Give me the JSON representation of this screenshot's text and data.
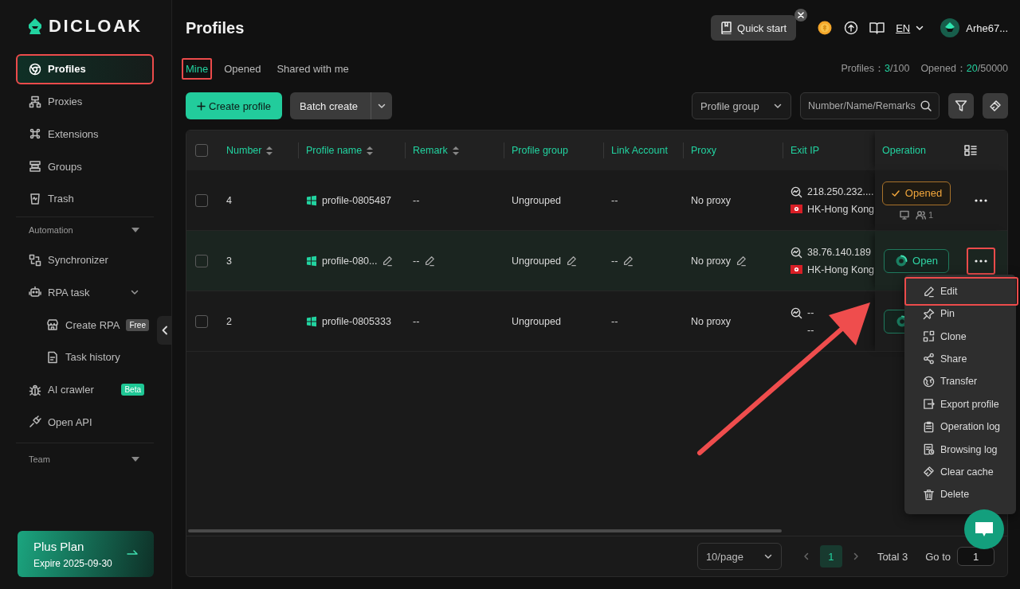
{
  "sidebar": {
    "logo": "DICLOAK",
    "items": [
      {
        "label": "Profiles",
        "selected": true,
        "annotated": true
      },
      {
        "label": "Proxies",
        "selected": false,
        "annotated": false
      },
      {
        "label": "Extensions",
        "selected": false,
        "annotated": false
      },
      {
        "label": "Groups",
        "selected": false,
        "annotated": false
      },
      {
        "label": "Trash",
        "selected": false,
        "annotated": false
      }
    ],
    "sections": [
      {
        "title": "Automation",
        "items": [
          {
            "label": "Synchronizer",
            "selected": false
          },
          {
            "label": "RPA task",
            "selected": false,
            "expanded": true,
            "children": [
              {
                "label": "Create RPA",
                "selected": false,
                "badge": {
                  "text": "Free",
                  "color": "#4d4d4d"
                }
              },
              {
                "label": "Task history",
                "selected": false
              }
            ]
          },
          {
            "label": "AI crawler",
            "selected": false,
            "badge": {
              "text": "Beta",
              "color": "#1fc795"
            }
          },
          {
            "label": "Open API",
            "selected": false
          }
        ]
      },
      {
        "title": "Team"
      }
    ],
    "plan": {
      "name": "Plus Plan",
      "expiry": "Expire 2025-09-30"
    }
  },
  "header": {
    "title": "Profiles",
    "quick_start": "Quick start",
    "language": "EN",
    "user": "Arhe67..."
  },
  "tabs": [
    {
      "label": "Mine",
      "selected": true,
      "annotated": true
    },
    {
      "label": "Opened",
      "selected": false,
      "annotated": false
    },
    {
      "label": "Shared with me",
      "selected": false,
      "annotated": false
    }
  ],
  "stats": [
    {
      "label": "Profiles：",
      "used": "3",
      "total": "/100"
    },
    {
      "label": "Opened：",
      "used": "20",
      "total": "/50000"
    }
  ],
  "toolbar": {
    "create": "Create profile",
    "batch": "Batch create",
    "group_select": "Profile group",
    "search_placeholder": "Number/Name/Remarks"
  },
  "table": {
    "select_all": {
      "checked": false
    },
    "columns": [
      {
        "label": "Number",
        "sortable": true
      },
      {
        "label": "Profile name",
        "sortable": true
      },
      {
        "label": "Remark",
        "sortable": true
      },
      {
        "label": "Profile group",
        "sortable": false
      },
      {
        "label": "Link Account",
        "sortable": false
      },
      {
        "label": "Proxy",
        "sortable": false
      },
      {
        "label": "Exit IP",
        "sortable": false
      },
      {
        "label": "Operation",
        "sortable": false
      }
    ],
    "rows": [
      {
        "checked": false,
        "selected": false,
        "number": "4",
        "name": "profile-0805487",
        "remark": "--",
        "group": "Ungrouped",
        "link_account": "--",
        "proxy": "No proxy",
        "exit_ip": "218.250.232....",
        "location": "HK-Hong Kong",
        "flag": true,
        "action": {
          "kind": "opened",
          "label": "Opened"
        },
        "viewers": "1",
        "more_annotated": false
      },
      {
        "checked": false,
        "selected": true,
        "number": "3",
        "name": "profile-080...",
        "remark": "--",
        "group": "Ungrouped",
        "link_account": "--",
        "proxy": "No proxy",
        "exit_ip": "38.76.140.189",
        "location": "HK-Hong Kong",
        "flag": true,
        "action": {
          "kind": "open",
          "label": "Open"
        },
        "more_annotated": true
      },
      {
        "checked": false,
        "selected": false,
        "number": "2",
        "name": "profile-0805333",
        "remark": "--",
        "group": "Ungrouped",
        "link_account": "--",
        "proxy": "No proxy",
        "exit_ip": "--",
        "location": "--",
        "flag": false,
        "action": {
          "kind": "open"
        }
      }
    ]
  },
  "menu": {
    "items": [
      {
        "label": "Edit",
        "annotated": true
      },
      {
        "label": "Pin",
        "annotated": false
      },
      {
        "label": "Clone",
        "annotated": false
      },
      {
        "label": "Share",
        "annotated": false
      },
      {
        "label": "Transfer",
        "annotated": false
      },
      {
        "label": "Export profile",
        "annotated": false
      },
      {
        "label": "Operation log",
        "annotated": false
      },
      {
        "label": "Browsing log",
        "annotated": false
      },
      {
        "label": "Clear cache",
        "annotated": false
      },
      {
        "label": "Delete",
        "annotated": false
      }
    ]
  },
  "pagination": {
    "page_size": "10/page",
    "pages": [
      {
        "label": "1",
        "selected": true
      }
    ],
    "total": "Total 3",
    "goto_label": "Go to",
    "goto_value": "1"
  }
}
